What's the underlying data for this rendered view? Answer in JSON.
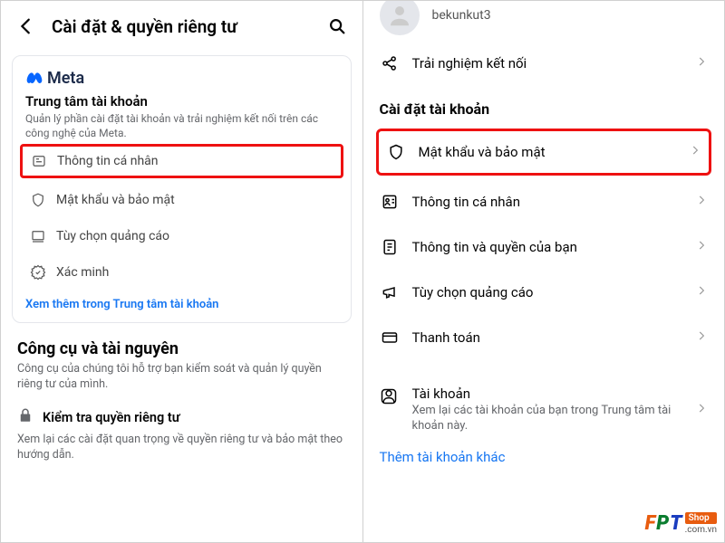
{
  "left": {
    "title": "Cài đặt & quyền riêng tư",
    "card": {
      "brand": "Meta",
      "heading": "Trung tâm tài khoản",
      "sub": "Quản lý phần cài đặt tài khoản và trải nghiệm kết nối trên các công nghệ của Meta.",
      "items": [
        {
          "label": "Thông tin cá nhân",
          "highlight": true
        },
        {
          "label": "Mật khẩu và bảo mật"
        },
        {
          "label": "Tùy chọn quảng cáo"
        },
        {
          "label": "Xác minh"
        }
      ],
      "more": "Xem thêm trong Trung tâm tài khoản"
    },
    "tools": {
      "heading": "Công cụ và tài nguyên",
      "sub": "Công cụ của chúng tôi hỗ trợ bạn kiểm soát và quản lý quyền riêng tư của mình.",
      "check": "Kiểm tra quyền riêng tư",
      "check_sub": "Xem lại các cài đặt quan trọng về quyền riêng tư và bảo mật theo hướng dẫn."
    }
  },
  "right": {
    "username": "bekunkut3",
    "row_top": "Trải nghiệm kết nối",
    "section": "Cài đặt tài khoản",
    "items": [
      {
        "label": "Mật khẩu và bảo mật",
        "highlight": true
      },
      {
        "label": "Thông tin cá nhân"
      },
      {
        "label": "Thông tin và quyền của bạn"
      },
      {
        "label": "Tùy chọn quảng cáo"
      },
      {
        "label": "Thanh toán"
      }
    ],
    "account": {
      "title": "Tài khoản",
      "sub": "Xem lại các tài khoản của bạn trong Trung tâm tài khoản này."
    },
    "add_link": "Thêm tài khoản khác"
  },
  "watermark": {
    "shop": "Shop",
    "domain": ".com.vn"
  }
}
